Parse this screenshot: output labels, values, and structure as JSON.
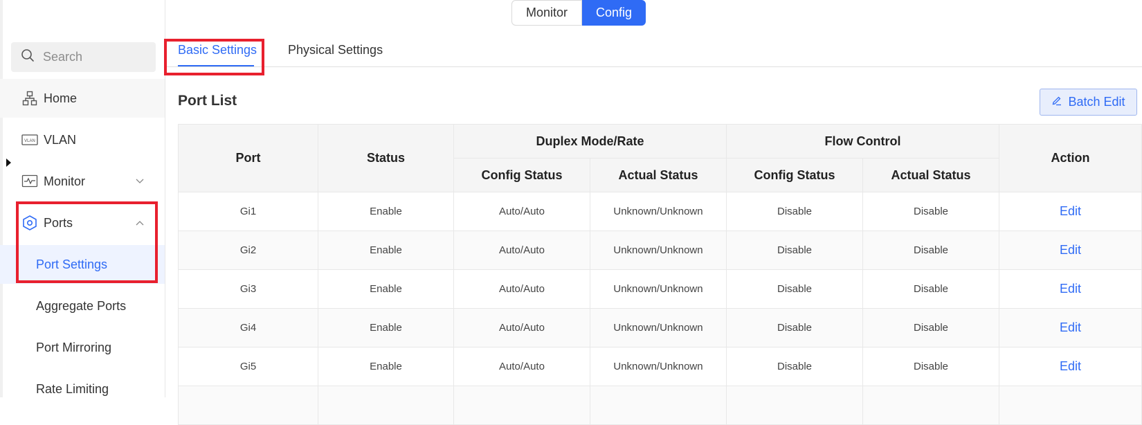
{
  "mode_switch": {
    "monitor_label": "Monitor",
    "config_label": "Config",
    "active": "Config"
  },
  "sidebar": {
    "search_placeholder": "Search",
    "items": [
      {
        "label": "Home",
        "icon": "network-topology-icon"
      },
      {
        "label": "VLAN",
        "icon": "vlan-icon"
      },
      {
        "label": "Monitor",
        "icon": "monitor-pulse-icon",
        "expanded": false
      },
      {
        "label": "Ports",
        "icon": "port-hexagon-icon",
        "expanded": true
      }
    ],
    "sub_items": [
      {
        "label": "Port Settings",
        "active": true
      },
      {
        "label": "Aggregate Ports"
      },
      {
        "label": "Port Mirroring"
      },
      {
        "label": "Rate Limiting"
      }
    ]
  },
  "tabs": [
    {
      "label": "Basic Settings",
      "active": true
    },
    {
      "label": "Physical Settings"
    }
  ],
  "main": {
    "title": "Port List",
    "batch_edit_label": "Batch Edit"
  },
  "table": {
    "headers": {
      "port": "Port",
      "status": "Status",
      "duplex_group": "Duplex Mode/Rate",
      "flow_group": "Flow Control",
      "config_status": "Config Status",
      "actual_status": "Actual Status",
      "action": "Action"
    },
    "rows": [
      {
        "port": "Gi1",
        "status": "Enable",
        "duplex_config": "Auto/Auto",
        "duplex_actual": "Unknown/Unknown",
        "flow_config": "Disable",
        "flow_actual": "Disable",
        "action": "Edit"
      },
      {
        "port": "Gi2",
        "status": "Enable",
        "duplex_config": "Auto/Auto",
        "duplex_actual": "Unknown/Unknown",
        "flow_config": "Disable",
        "flow_actual": "Disable",
        "action": "Edit"
      },
      {
        "port": "Gi3",
        "status": "Enable",
        "duplex_config": "Auto/Auto",
        "duplex_actual": "Unknown/Unknown",
        "flow_config": "Disable",
        "flow_actual": "Disable",
        "action": "Edit"
      },
      {
        "port": "Gi4",
        "status": "Enable",
        "duplex_config": "Auto/Auto",
        "duplex_actual": "Unknown/Unknown",
        "flow_config": "Disable",
        "flow_actual": "Disable",
        "action": "Edit"
      },
      {
        "port": "Gi5",
        "status": "Enable",
        "duplex_config": "Auto/Auto",
        "duplex_actual": "Unknown/Unknown",
        "flow_config": "Disable",
        "flow_actual": "Disable",
        "action": "Edit"
      },
      {
        "port": "",
        "status": "",
        "duplex_config": "",
        "duplex_actual": "",
        "flow_config": "",
        "flow_actual": "",
        "action": ""
      }
    ]
  },
  "colors": {
    "accent": "#2f6bf5",
    "highlight": "#e8202e",
    "header_bg": "#f5f5f5"
  }
}
